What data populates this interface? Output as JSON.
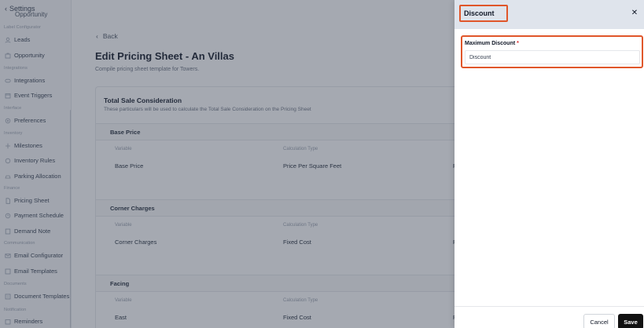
{
  "sidebar": {
    "back_label": "Settings",
    "cut_item": "Opportunity",
    "sections": [
      {
        "label": "Label Configurator",
        "items": [
          {
            "label": "Leads",
            "icon": "leads-icon"
          },
          {
            "label": "Opportunity",
            "icon": "opportunity-icon"
          }
        ]
      },
      {
        "label": "Integrations",
        "items": [
          {
            "label": "Integrations",
            "icon": "integrations-icon"
          },
          {
            "label": "Event Triggers",
            "icon": "event-triggers-icon"
          }
        ]
      },
      {
        "label": "Interface",
        "items": [
          {
            "label": "Preferences",
            "icon": "preferences-icon"
          }
        ]
      },
      {
        "label": "Inventory",
        "items": [
          {
            "label": "Milestones",
            "icon": "milestones-icon"
          },
          {
            "label": "Inventory Rules",
            "icon": "inventory-rules-icon"
          },
          {
            "label": "Parking Allocation",
            "icon": "parking-icon"
          }
        ]
      },
      {
        "label": "Finance",
        "items": [
          {
            "label": "Pricing Sheet",
            "icon": "pricing-sheet-icon"
          },
          {
            "label": "Payment Schedule",
            "icon": "payment-schedule-icon"
          },
          {
            "label": "Demand Note",
            "icon": "demand-note-icon"
          }
        ]
      },
      {
        "label": "Communication",
        "items": [
          {
            "label": "Email Configurator",
            "icon": "email-configurator-icon"
          },
          {
            "label": "Email Templates",
            "icon": "email-templates-icon"
          }
        ]
      },
      {
        "label": "Documents",
        "items": [
          {
            "label": "Document Templates",
            "icon": "document-templates-icon"
          }
        ]
      },
      {
        "label": "Notification",
        "items": [
          {
            "label": "Reminders",
            "icon": "reminders-icon"
          }
        ]
      }
    ]
  },
  "main": {
    "back_label": "Back",
    "title": "Edit Pricing Sheet - An Villas",
    "subtitle": "Compile pricing sheet template for Towers.",
    "card": {
      "title": "Total Sale Consideration",
      "subtitle": "These particulars will be used to calculate the Total Sale Consideration on the Pricing Sheet",
      "col_variable": "Variable",
      "col_calc": "Calculation Type",
      "groups": [
        {
          "name": "Base Price",
          "variable": "Base Price",
          "calc": "Price Per Square Feet",
          "cut": "P"
        },
        {
          "name": "Corner Charges",
          "variable": "Corner Charges",
          "calc": "Fixed Cost",
          "cut": "P"
        },
        {
          "name": "Facing",
          "variable": "East",
          "calc": "Fixed Cost",
          "cut": "P"
        }
      ]
    }
  },
  "drawer": {
    "title": "Discount",
    "close_icon": "close-icon",
    "field_label": "Maximum Discount",
    "required_mark": "*",
    "input_placeholder": "Discount",
    "cancel_label": "Cancel",
    "save_label": "Save"
  },
  "colors": {
    "highlight": "#e0562a",
    "overlay": "#374151",
    "save_bg": "#111111",
    "header_bg": "#dfe4ec"
  }
}
